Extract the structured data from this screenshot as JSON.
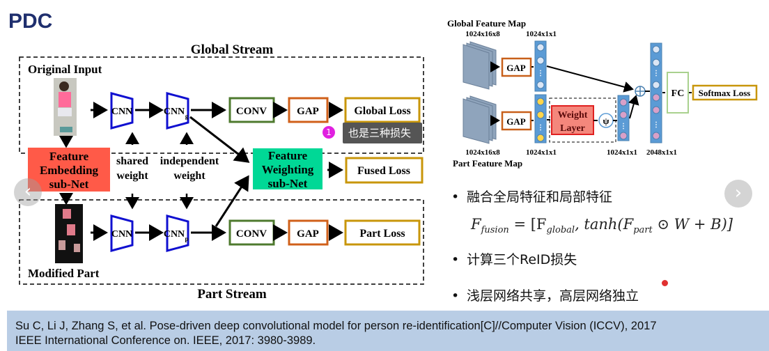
{
  "slide_title": "PDC",
  "left_diagram": {
    "global_stream": "Global Stream",
    "part_stream": "Part Stream",
    "original_input": "Original Input",
    "modified_part": "Modified Part",
    "cnn": "CNN",
    "cnn_g": "CNN",
    "cnn_g_sub": "g",
    "cnn_p": "CNN",
    "cnn_p_sub": "p",
    "conv": "CONV",
    "gap": "GAP",
    "global_loss": "Global Loss",
    "part_loss": "Part Loss",
    "fused_loss": "Fused Loss",
    "feature_embedding": [
      "Feature",
      "Embedding",
      "sub-Net"
    ],
    "feature_weighting": [
      "Feature",
      "Weighting",
      "sub-Net"
    ],
    "shared_weight": [
      "shared",
      "weight"
    ],
    "independent_weight": [
      "independent",
      "weight"
    ]
  },
  "right_diagram": {
    "global_feature_map": "Global Feature Map",
    "part_feature_map": "Part Feature Map",
    "dim_map": "1024x16x8",
    "dim_vec": "1024x1x1",
    "dim_concat": "2048x1x1",
    "gap": "GAP",
    "weight_layer": [
      "Weight",
      "Layer"
    ],
    "psi": "ψ",
    "fc": "FC",
    "softmax_loss": "Softmax Loss"
  },
  "tooltip": {
    "badge": "1",
    "text": "也是三种损失"
  },
  "bullets": [
    "融合全局特征和局部特征",
    "计算三个ReID损失",
    "浅层网络共享，高层网络独立"
  ],
  "formula": {
    "lhs": "F",
    "lhs_sub": "fusion",
    "rhs_a": " = [F",
    "rhs_a_sub": "global",
    "rhs_b": ", tanh(F",
    "rhs_b_sub": "part",
    "rhs_c": " ⊙ W + B)]"
  },
  "citation": [
    "Su C, Li J, Zhang S, et al. Pose-driven deep convolutional model for person re-identification[C]//Computer Vision (ICCV), 2017",
    "IEEE International Conference on. IEEE, 2017: 3980-3989."
  ],
  "nav": {
    "prev": "‹",
    "next": "›"
  },
  "colors": {
    "title": "#1f2f6e",
    "cnn": "#1010d0",
    "conv": "#4e7a2e",
    "gap": "#d0601a",
    "loss": "#c8960a",
    "embedding": "#ff5a48",
    "weighting": "#00d896",
    "citation_bg": "#b9cde5"
  }
}
